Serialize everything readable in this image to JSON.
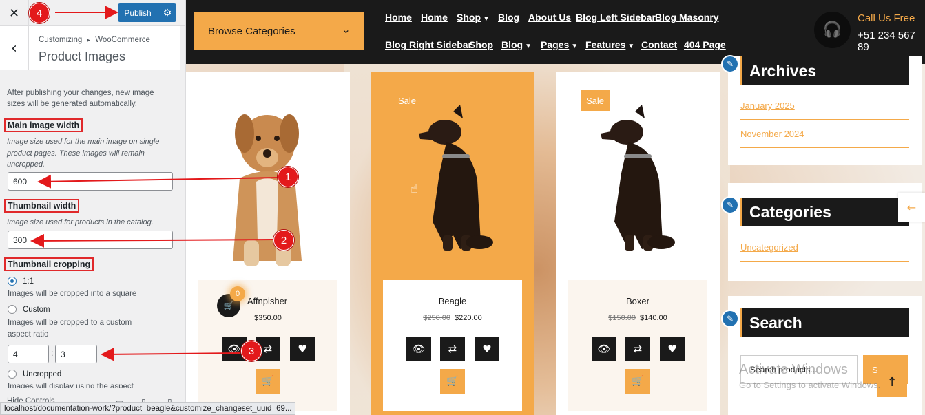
{
  "customizer": {
    "close_label": "✕",
    "publish_label": "Publish",
    "breadcrumb_prefix": "Customizing",
    "breadcrumb_sep": "▸",
    "breadcrumb_section": "WooCommerce",
    "section_title": "Product Images",
    "note": "After publishing your changes, new image sizes will be generated automatically.",
    "main_width": {
      "label": "Main image width",
      "description": "Image size used for the main image on single product pages. These images will remain uncropped.",
      "value": "600"
    },
    "thumb_width": {
      "label": "Thumbnail width",
      "description": "Image size used for products in the catalog.",
      "value": "300"
    },
    "cropping": {
      "label": "Thumbnail cropping",
      "options": [
        {
          "label": "1:1",
          "description": "Images will be cropped into a square",
          "selected": true
        },
        {
          "label": "Custom",
          "description": "Images will be cropped to a custom aspect ratio",
          "selected": false
        },
        {
          "label": "Uncropped",
          "description": "Images will display using the aspect",
          "selected": false
        }
      ],
      "ratio_w": "4",
      "ratio_sep": ":",
      "ratio_h": "3"
    },
    "hide_controls": "Hide Controls"
  },
  "annotations": [
    "1",
    "2",
    "3",
    "4"
  ],
  "site": {
    "browse_categories": "Browse Categories",
    "nav_row1": [
      {
        "label": "Home",
        "caret": false
      },
      {
        "label": "Home",
        "caret": false
      },
      {
        "label": "Shop",
        "caret": true
      },
      {
        "label": "Blog",
        "caret": false
      },
      {
        "label": "About Us",
        "caret": false
      },
      {
        "label": "Blog Left Sidebar",
        "caret": false
      },
      {
        "label": "Blog Masonry",
        "caret": false
      }
    ],
    "nav_row2": [
      {
        "label": "Blog Right Sidebar",
        "caret": false
      },
      {
        "label": "Shop",
        "caret": false
      },
      {
        "label": "Blog",
        "caret": true
      },
      {
        "label": "Pages",
        "caret": true
      },
      {
        "label": "Features",
        "caret": true
      },
      {
        "label": "Contact",
        "caret": false
      },
      {
        "label": "404 Page",
        "caret": false
      }
    ],
    "call_label": "Call Us Free",
    "call_number": "+51 234 567 89",
    "mini_cart_count": "0",
    "products": [
      {
        "name": "Affnpisher",
        "old_price": "",
        "price": "$350.00",
        "sale": ""
      },
      {
        "name": "Beagle",
        "old_price": "$250.00",
        "price": "$220.00",
        "sale": "Sale"
      },
      {
        "name": "Boxer",
        "old_price": "$150.00",
        "price": "$140.00",
        "sale": "Sale"
      }
    ],
    "widgets": {
      "archives": {
        "title": "Archives",
        "links": [
          "January 2025",
          "November 2024"
        ]
      },
      "categories": {
        "title": "Categories",
        "links": [
          "Uncategorized"
        ]
      },
      "search": {
        "title": "Search",
        "placeholder": "Search products...",
        "button": "S"
      }
    },
    "watermark_title": "Activate Windows",
    "watermark_sub": "Go to Settings to activate Windows."
  },
  "status_url": "localhost/documentation-work/?product=beagle&customize_changeset_uuid=69...",
  "colors": {
    "accent": "#f4a949",
    "dark": "#1a1a1a",
    "wp_blue": "#2271b1",
    "annotation_red": "#e3191b"
  }
}
